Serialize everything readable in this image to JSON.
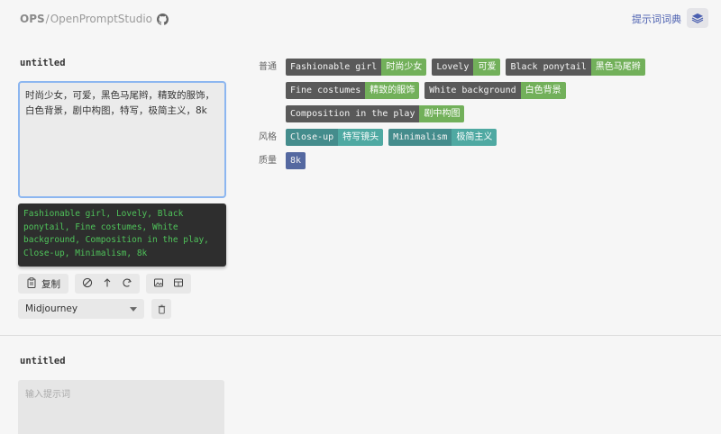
{
  "header": {
    "brand_ops": "OPS",
    "brand_sep": "/",
    "brand_name": "OpenPromptStudio",
    "dict_link": "提示词词典",
    "icons": {
      "github": "github-icon",
      "layers": "layers-icon"
    }
  },
  "editors": [
    {
      "title": "untitled",
      "input_value": "时尚少女，可爱，黑色马尾辫，精致的服饰，白色背景，剧中构图，特写，极简主义，8k",
      "output": "Fashionable girl, Lovely, Black ponytail, Fine costumes, White background, Composition in the play, Close-up, Minimalism, 8k",
      "copy_label": "复制",
      "model_select": "Midjourney"
    },
    {
      "title": "untitled",
      "input_placeholder": "输入提示词"
    }
  ],
  "tag_groups": [
    {
      "label": "普通",
      "tags": [
        {
          "en": "Fashionable girl",
          "zh": "时尚少女"
        },
        {
          "en": "Lovely",
          "zh": "可爱"
        },
        {
          "en": "Black ponytail",
          "zh": "黑色马尾辫"
        },
        {
          "en": "Fine costumes",
          "zh": "精致的服饰"
        },
        {
          "en": "White background",
          "zh": "白色背景"
        },
        {
          "en": "Composition in the play",
          "zh": "剧中构图"
        }
      ]
    },
    {
      "label": "风格",
      "tags": [
        {
          "en": "Close-up",
          "zh": "特写镜头"
        },
        {
          "en": "Minimalism",
          "zh": "极简主义"
        }
      ]
    },
    {
      "label": "质量",
      "tags": [
        {
          "en": "8k",
          "zh": ""
        }
      ]
    }
  ],
  "colors": {
    "tag_en_dark": "#595959",
    "tag_zh_green": "#72b05a",
    "style_en": "#448c8c",
    "style_zh": "#4fa9a2",
    "quality": "#5468a0",
    "output_text": "#4fc35a",
    "focus_border": "#8cb6f0"
  }
}
